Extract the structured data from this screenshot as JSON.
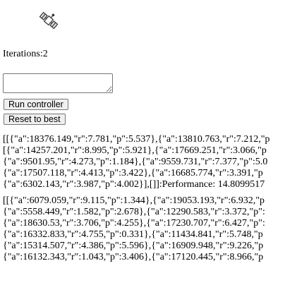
{
  "header": {
    "icon": "satellite-icon",
    "iterations_label": "Iterations:2"
  },
  "controls": {
    "input_value": "",
    "run_label": "Run controller",
    "reset_label": "Reset to best"
  },
  "output": {
    "block1": [
      "[[{\"a\":18376.149,\"r\":7.781,\"p\":5.537},{\"a\":13810.763,\"r\":7.212,\"p",
      "[{\"a\":14257.201,\"r\":8.995,\"p\":5.921},{\"a\":17669.251,\"r\":3.066,\"p",
      "{\"a\":9501.95,\"r\":4.273,\"p\":1.184},{\"a\":9559.731,\"r\":7.377,\"p\":5.0",
      "{\"a\":17507.118,\"r\":4.413,\"p\":3.422},{\"a\":16685.774,\"r\":3.391,\"p",
      "{\"a\":6302.143,\"r\":3.987,\"p\":4.002}],[]]:Performance: 14.8099517"
    ],
    "block2": [
      "[[{\"a\":6079.059,\"r\":9.115,\"p\":1.344},{\"a\":19053.193,\"r\":6.932,\"p",
      "{\"a\":5558.449,\"r\":1.582,\"p\":2.678},{\"a\":12290.583,\"r\":3.372,\"p\":",
      "{\"a\":18630.53,\"r\":3.706,\"p\":4.255},{\"a\":17230.707,\"r\":6.427,\"p\":",
      "{\"a\":16332.833,\"r\":4.755,\"p\":0.331},{\"a\":11434.841,\"r\":5.748,\"p",
      "{\"a\":15314.507,\"r\":4.386,\"p\":5.596},{\"a\":16909.948,\"r\":9.226,\"p",
      "{\"a\":16132.343,\"r\":1.043,\"p\":3.406},{\"a\":17120.445,\"r\":8.966,\"p"
    ]
  }
}
